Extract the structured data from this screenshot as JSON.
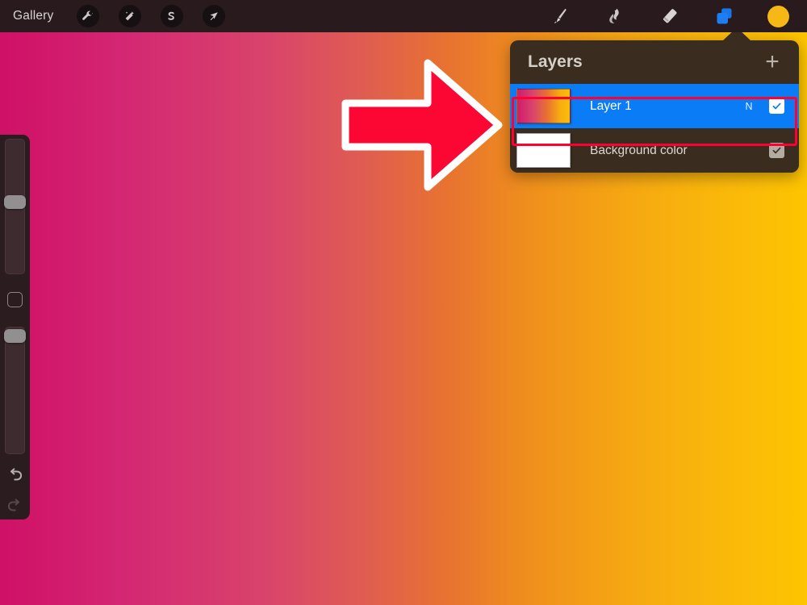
{
  "topbar": {
    "gallery_label": "Gallery",
    "left_tools": [
      {
        "name": "wrench-icon",
        "label": "Actions"
      },
      {
        "name": "wand-icon",
        "label": "Adjustments"
      },
      {
        "name": "s-curve-icon",
        "label": "Selection"
      },
      {
        "name": "arrow-icon",
        "label": "Transform"
      }
    ],
    "right_tools": [
      {
        "name": "paintbrush-icon",
        "label": "Paint",
        "active": false
      },
      {
        "name": "smudge-icon",
        "label": "Smudge",
        "active": false
      },
      {
        "name": "eraser-icon",
        "label": "Erase",
        "active": false
      },
      {
        "name": "layers-icon",
        "label": "Layers",
        "active": true
      }
    ],
    "color_swatch": {
      "name": "color-swatch",
      "hex": "#f5b814"
    },
    "background_hex": "#281a1d"
  },
  "sidebar": {
    "brush_size_slider": {
      "label": "Brush size",
      "value": 55
    },
    "modify_button": {
      "label": "Modify"
    },
    "brush_opacity_slider": {
      "label": "Brush opacity",
      "value": 98
    },
    "undo_button": {
      "label": "Undo",
      "enabled": true
    },
    "redo_button": {
      "label": "Redo",
      "enabled": false
    }
  },
  "layers_panel": {
    "title": "Layers",
    "add_button_label": "+",
    "rows": [
      {
        "name": "Layer 1",
        "blend_mode": "N",
        "visible": true,
        "selected": true,
        "thumbnail": "gradient-magenta-to-yellow"
      },
      {
        "name": "Background color",
        "blend_mode": "",
        "visible": true,
        "selected": false,
        "thumbnail": "white"
      }
    ],
    "panel_hex": "#3a2d1f",
    "selected_row_hex": "#0a7cf5",
    "highlight_hex": "#ff0033"
  },
  "canvas": {
    "description": "Horizontal gradient artwork",
    "gradient_start_hex": "#cf1167",
    "gradient_end_hex": "#fdc400"
  },
  "annotation": {
    "arrow": {
      "label": "pointer-arrow-to-layers-panel",
      "fill_hex": "#ff0033",
      "stroke_hex": "#ffffff"
    }
  }
}
